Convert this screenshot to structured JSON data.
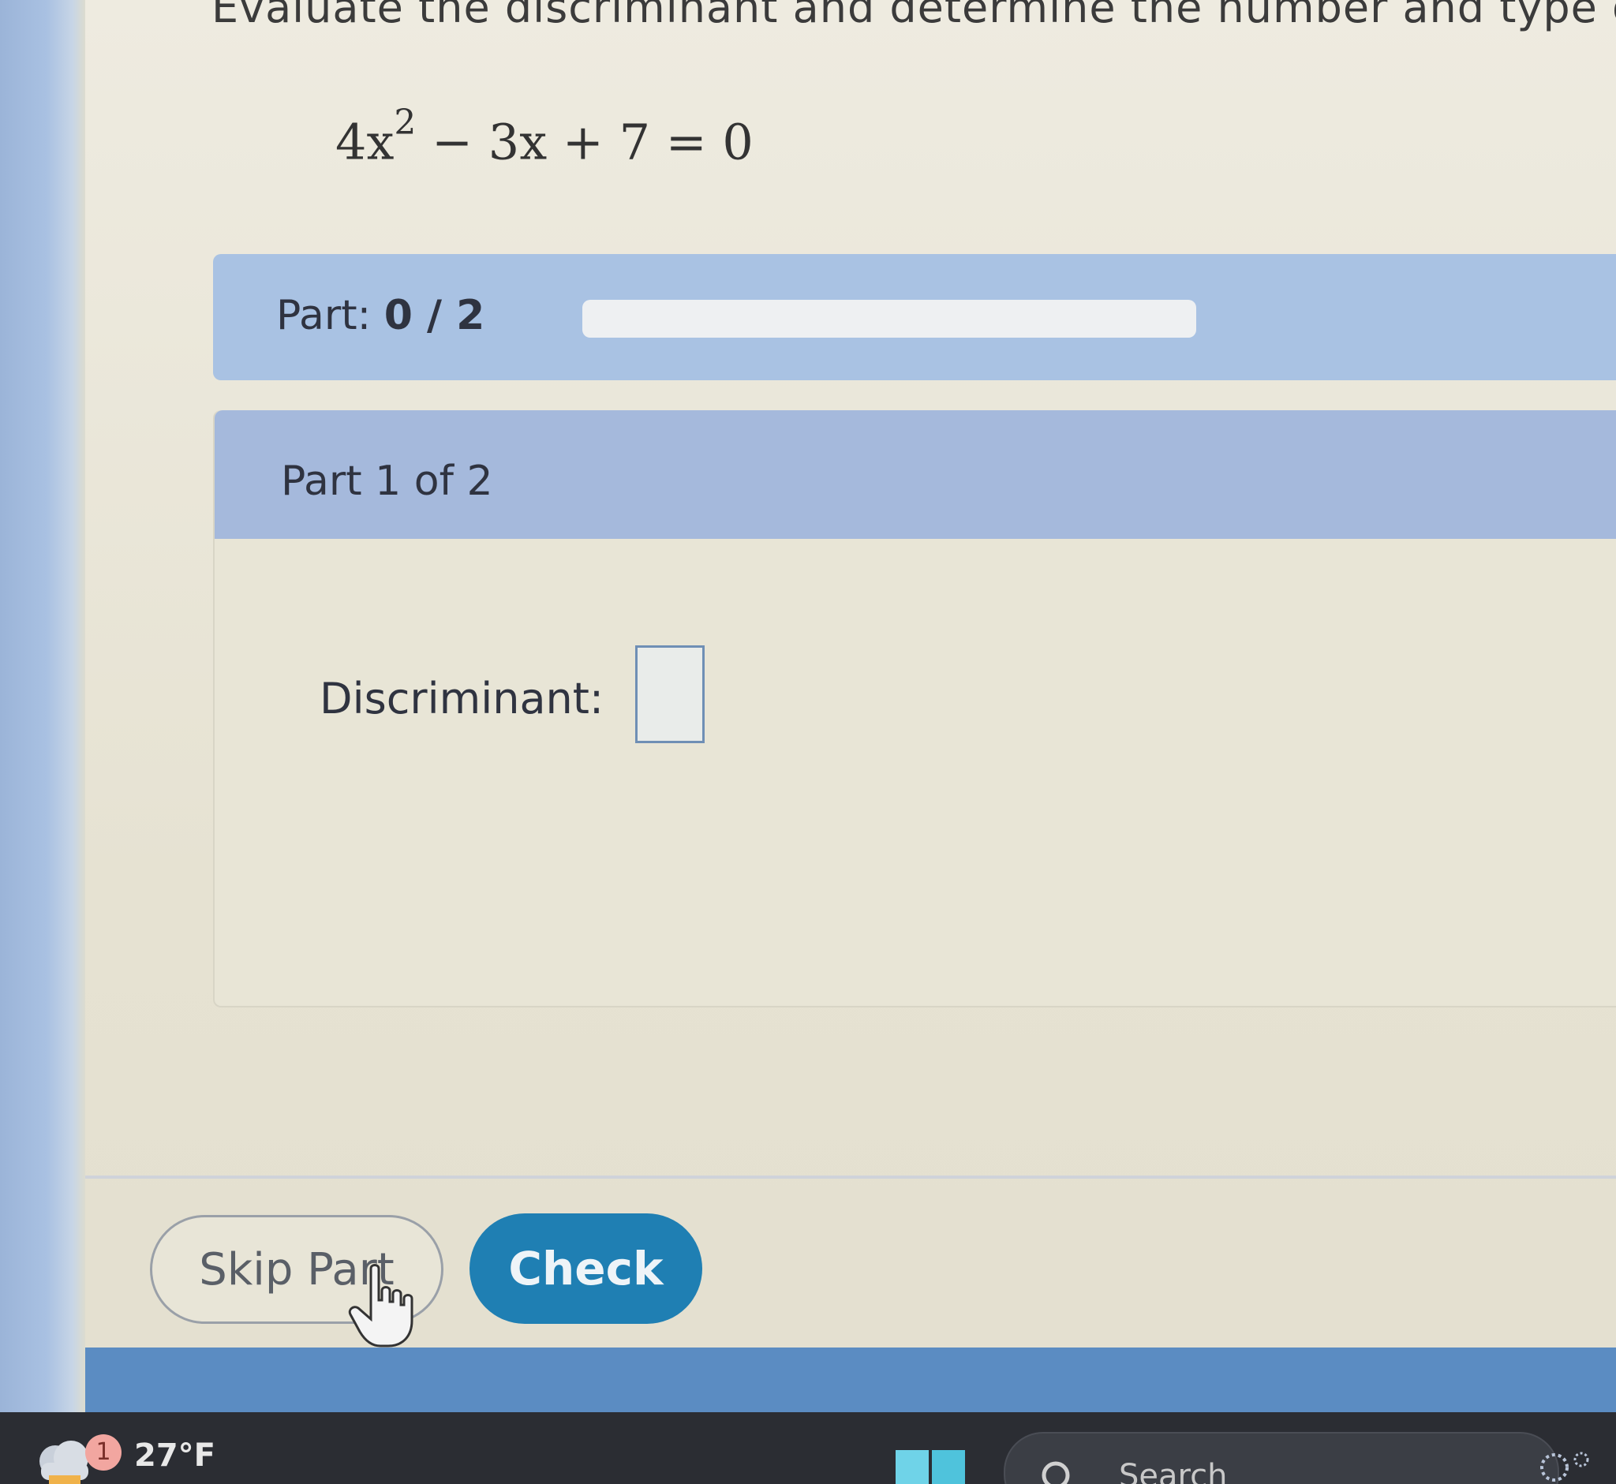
{
  "question": {
    "text": "Evaluate the discriminant and determine the number and type o",
    "equation_lead": "4x",
    "equation_exp": "2",
    "equation_rest": " − 3x + 7 = 0"
  },
  "progress": {
    "label": "Part: ",
    "value": "0 / 2",
    "completed": 0,
    "total": 2
  },
  "part": {
    "title": "Part 1 of 2",
    "discriminant_label": "Discriminant:",
    "discriminant_value": ""
  },
  "actions": {
    "skip_label": "Skip Part",
    "check_label": "Check"
  },
  "taskbar": {
    "weather_badge": "1",
    "temperature": "27°F",
    "search_text": "Search"
  },
  "colors": {
    "accent": "#1f7fb3",
    "progress_band": "#a9c2e3",
    "part_header": "#a5b9dc"
  }
}
